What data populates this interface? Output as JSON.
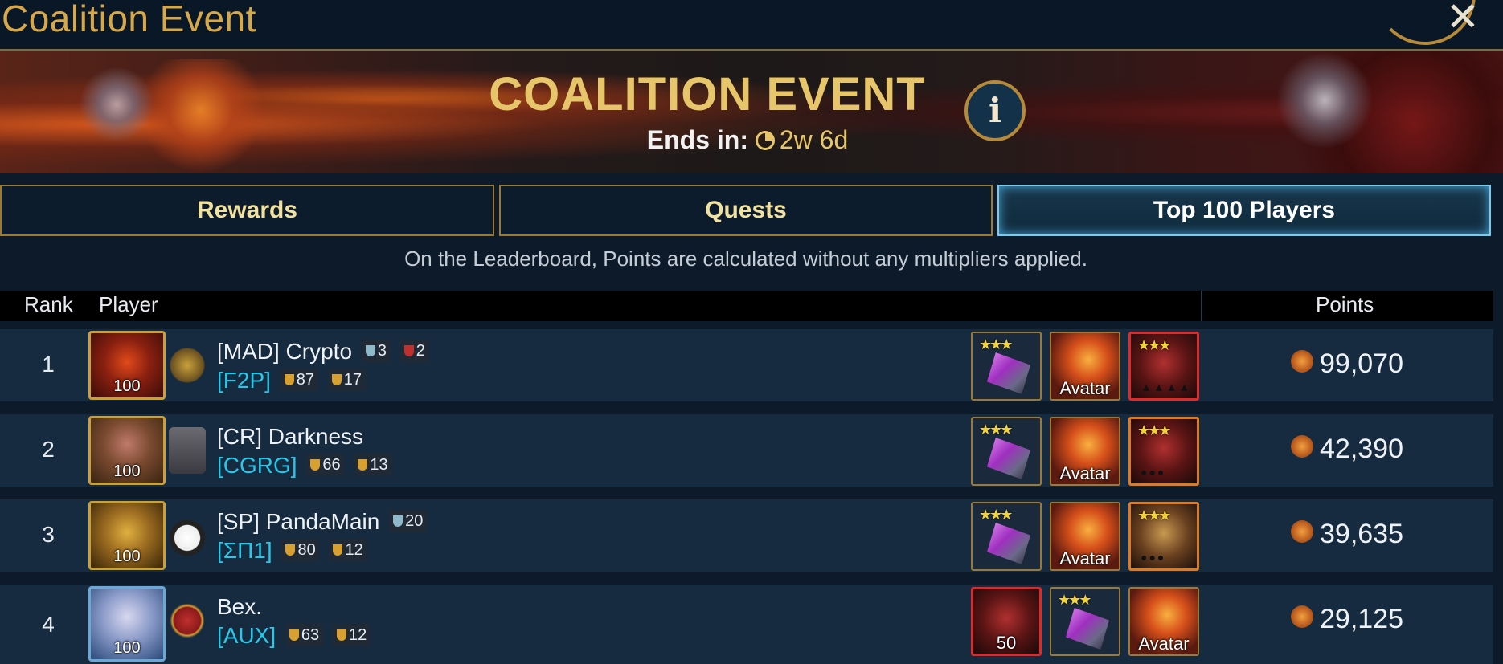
{
  "window": {
    "title": "Coalition Event"
  },
  "banner": {
    "title": "COALITION EVENT",
    "ends_label": "Ends in:",
    "ends_value": "2w 6d"
  },
  "tabs": [
    {
      "label": "Rewards",
      "active": false
    },
    {
      "label": "Quests",
      "active": false
    },
    {
      "label": "Top 100 Players",
      "active": true
    }
  ],
  "notice": "On the Leaderboard, Points are calculated without any multipliers applied.",
  "table": {
    "headers": {
      "rank": "Rank",
      "player": "Player",
      "points": "Points"
    },
    "rows": [
      {
        "rank": "1",
        "level": "100",
        "name": "[MAD] Crypto",
        "name_badges": [
          {
            "cup": "silver",
            "value": "3"
          },
          {
            "cup": "red",
            "value": "2"
          }
        ],
        "clan": "[F2P]",
        "clan_badges": [
          {
            "cup": "gold",
            "value": "87"
          },
          {
            "cup": "gold",
            "value": "17"
          }
        ],
        "items": [
          "shard",
          "Avatar",
          "champion"
        ],
        "points": "99,070"
      },
      {
        "rank": "2",
        "level": "100",
        "name": "[CR] Darkness",
        "name_badges": [],
        "clan": "[CGRG]",
        "clan_badges": [
          {
            "cup": "gold",
            "value": "66"
          },
          {
            "cup": "gold",
            "value": "13"
          }
        ],
        "items": [
          "shard",
          "Avatar",
          "champion"
        ],
        "points": "42,390"
      },
      {
        "rank": "3",
        "level": "100",
        "name": "[SP] PandaMain",
        "name_badges": [
          {
            "cup": "silver",
            "value": "20"
          }
        ],
        "clan": "[ΣΠ1]",
        "clan_badges": [
          {
            "cup": "gold",
            "value": "80"
          },
          {
            "cup": "gold",
            "value": "12"
          }
        ],
        "items": [
          "shard",
          "Avatar",
          "champion"
        ],
        "points": "39,635"
      },
      {
        "rank": "4",
        "level": "100",
        "name": "Bex.",
        "name_badges": [],
        "clan": "[AUX]",
        "clan_badges": [
          {
            "cup": "gold",
            "value": "63"
          },
          {
            "cup": "gold",
            "value": "12"
          }
        ],
        "items": [
          "horn",
          "shard",
          "Avatar"
        ],
        "item_count": "50",
        "points": "29,125"
      }
    ]
  },
  "colors": {
    "accent_gold": "#d7a84a",
    "clan_cyan": "#29c7e8",
    "active_tab_border": "#7ec8e8"
  },
  "icons": [
    "close-icon",
    "info-icon",
    "clock-icon",
    "trophy-icon",
    "points-icon"
  ]
}
